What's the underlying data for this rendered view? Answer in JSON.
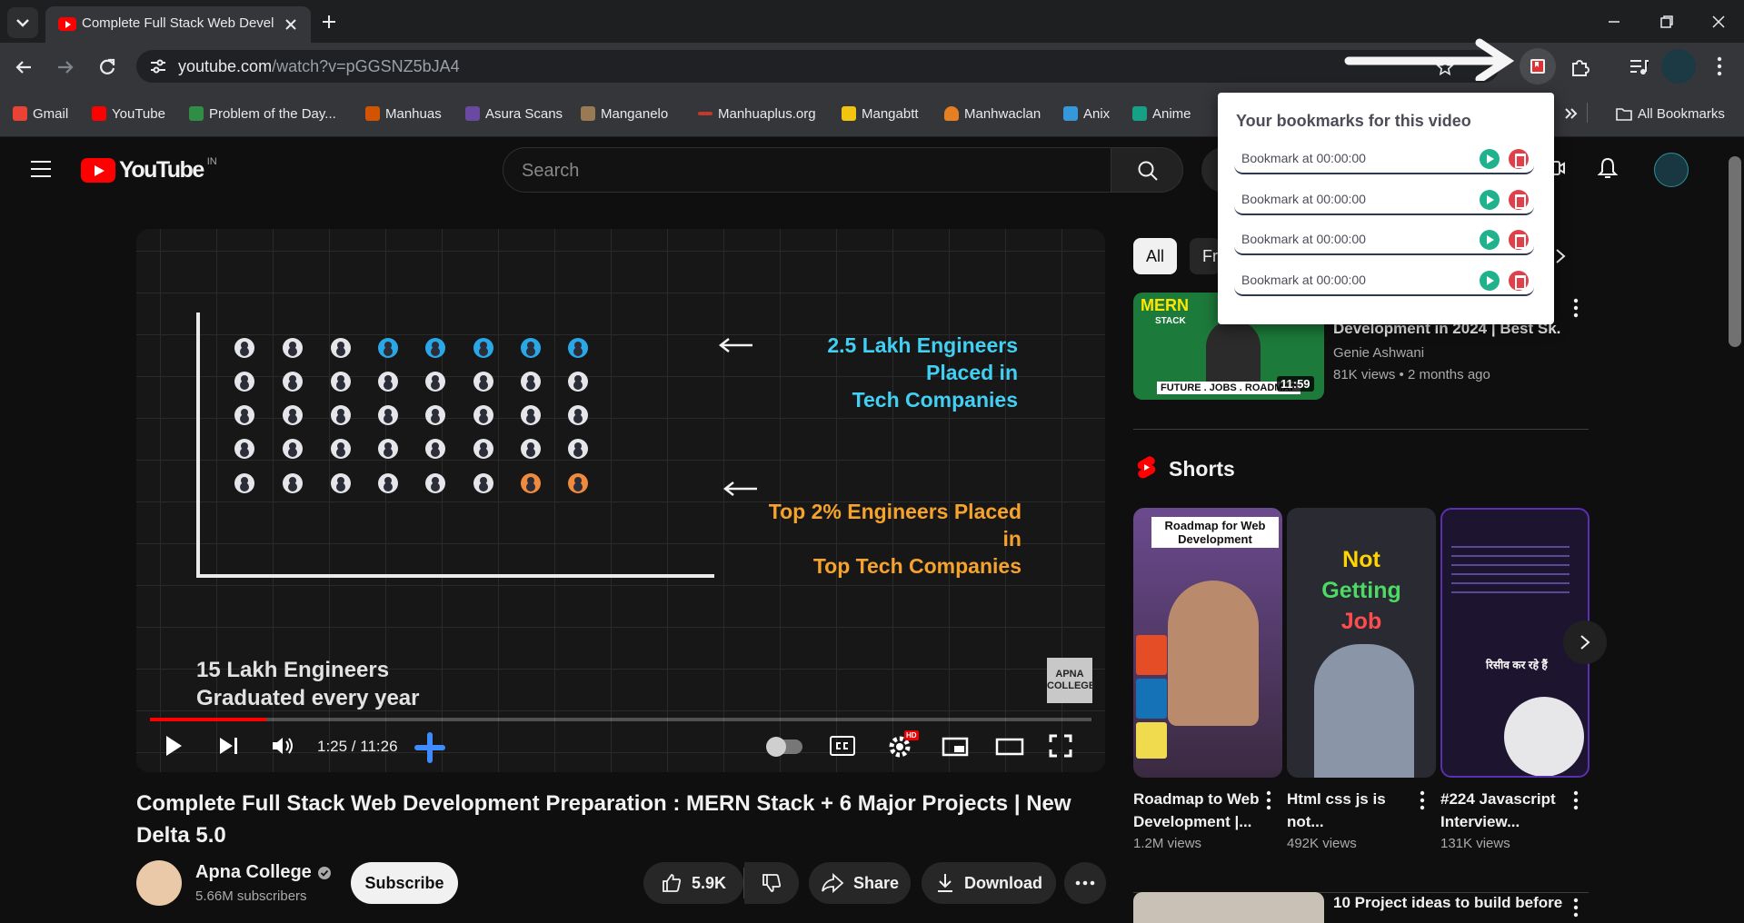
{
  "browser": {
    "tab_title": "Complete Full Stack Web Devel",
    "url_host": "youtube.com",
    "url_path": "/watch?v=pGGSNZ5bJA4",
    "bookmarks": [
      {
        "label": "Gmail",
        "color": "#ea4335"
      },
      {
        "label": "YouTube",
        "color": "#ff0000"
      },
      {
        "label": "Problem of the Day...",
        "color": "#2f8d46"
      },
      {
        "label": "Manhuas",
        "color": "#d35400"
      },
      {
        "label": "Asura Scans",
        "color": "#6a4aa0"
      },
      {
        "label": "Manganelo",
        "color": "#9a7a55"
      },
      {
        "label": "Manhuaplus.org",
        "color": "#c0392b"
      },
      {
        "label": "Mangabtt",
        "color": "#f1c40f"
      },
      {
        "label": "Manhwaclan",
        "color": "#e67e22"
      },
      {
        "label": "Anix",
        "color": "#3498db"
      },
      {
        "label": "Anime",
        "color": "#16a085"
      }
    ],
    "all_bookmarks": "All Bookmarks"
  },
  "youtube": {
    "logo_text": "YouTube",
    "region": "IN",
    "search_placeholder": "Search",
    "video": {
      "slide_top_label": "2.5 Lakh Engineers Placed in Tech Companies",
      "slide_top_line1": "2.5 Lakh Engineers Placed in",
      "slide_top_line2": "Tech Companies",
      "slide_bottom_line1": "Top 2% Engineers Placed in",
      "slide_bottom_line2": "Top Tech Companies",
      "caption_line1": "15 Lakh Engineers",
      "caption_line2": "Graduated every year",
      "watermark_line1": "APNA",
      "watermark_line2": "COLLEGE",
      "time": "1:25 / 11:26",
      "progress": 0.124,
      "hd_badge": "HD"
    },
    "title_line1": "Complete Full Stack Web Development Preparation : MERN Stack + 6 Major Projects | New",
    "title_line2": "Delta 5.0",
    "channel": "Apna College",
    "subscribers": "5.66M subscribers",
    "subscribe": "Subscribe",
    "likes": "5.9K",
    "share": "Share",
    "download": "Download",
    "chips": [
      "All",
      "Fr"
    ],
    "rec1": {
      "title": "Development in 2024 | Best Sk...",
      "channel": "Genie Ashwani",
      "meta": "81K views • 2 months ago",
      "duration": "11:59",
      "thumb_top": "MERN",
      "thumb_sub": "STACK",
      "thumb_bottom": "FUTURE . JOBS . ROADMAP"
    },
    "shorts_heading": "Shorts",
    "shorts": [
      {
        "title": "Roadmap to Web Development |...",
        "views": "1.2M views",
        "thumb_text": "Roadmap for Web Development"
      },
      {
        "title": "Html css js is not...",
        "views": "492K views",
        "thumb_line1": "Not",
        "thumb_line2": "Getting",
        "thumb_line3": "Job"
      },
      {
        "title": "#224 Javascript Interview...",
        "views": "131K views",
        "thumb_text": "रिसीव कर रहे हैं"
      }
    ],
    "rec2_title": "10 Project ideas to build before"
  },
  "extension_popup": {
    "title": "Your bookmarks for this video",
    "items": [
      {
        "label": "Bookmark at 00:00:00"
      },
      {
        "label": "Bookmark at 00:00:00"
      },
      {
        "label": "Bookmark at 00:00:00"
      },
      {
        "label": "Bookmark at 00:00:00"
      }
    ]
  }
}
